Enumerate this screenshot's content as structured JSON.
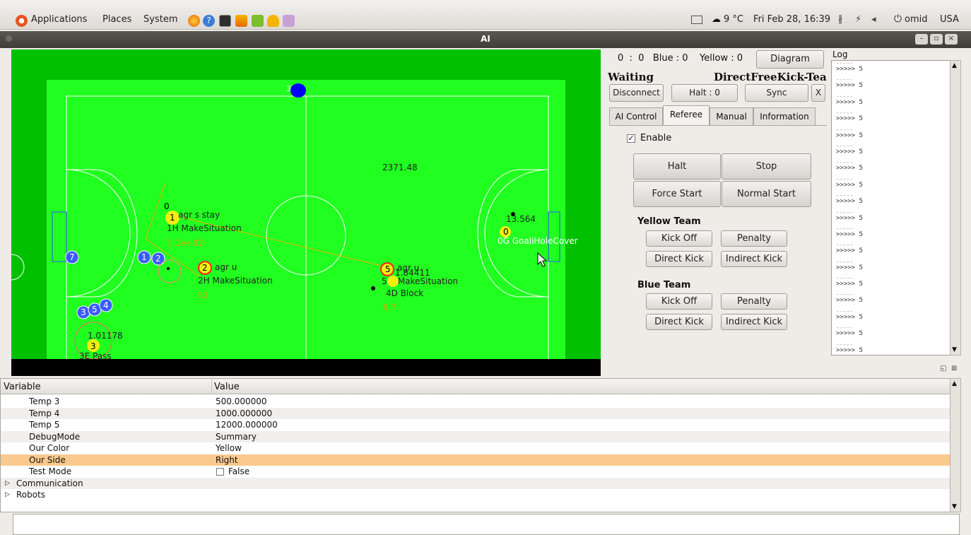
{
  "topbar": {
    "menus": [
      "Applications",
      "Places",
      "System"
    ],
    "weather": "9 °C",
    "datetime": "Fri Feb 28, 16:39",
    "user": "omid",
    "keyboard": "USA"
  },
  "window": {
    "title": "AI"
  },
  "field": {
    "center_value": "2371.48",
    "ball_label": "3",
    "robots": [
      {
        "num": "1",
        "team": "yellow",
        "line1": "agr s stay",
        "line2": "1H MakeSituation",
        "line3": "1.1e+02",
        "top": "0"
      },
      {
        "num": "2",
        "team": "yellow",
        "line1": "agr u",
        "line2": "2H MakeSituation",
        "line3": "51"
      },
      {
        "num": "5",
        "team": "yellow",
        "line1": "agr u",
        "line2": "5 4 MakeSituation",
        "line3": "1.84411"
      },
      {
        "num": "4",
        "team": "yellow",
        "line1": "4D Block",
        "line2": "8.7"
      },
      {
        "num": "0",
        "team": "yellow",
        "line1": "13.564",
        "line2": "0G GoaliHoleCover"
      },
      {
        "num": "3",
        "team": "yellow",
        "line1": "1.01178",
        "line2": "3E Pass"
      },
      {
        "num": "7",
        "team": "blue"
      },
      {
        "num": "1",
        "team": "blue"
      },
      {
        "num": "2",
        "team": "blue"
      },
      {
        "num": "3",
        "team": "blue"
      },
      {
        "num": "5",
        "team": "blue"
      },
      {
        "num": "4",
        "team": "blue"
      }
    ]
  },
  "control": {
    "score": "0  :  0   Blue : 0    Yellow : 0",
    "diagram_button": "Diagram",
    "status": "Waiting",
    "play": "DirectFreeKick-Tea",
    "disconnect_button": "Disconnect",
    "halt_button": "Halt : 0",
    "sync_button": "Sync",
    "close_button": "X",
    "tabs": [
      "AI Control",
      "Referee",
      "Manual",
      "Information"
    ],
    "enable_label": "Enable",
    "halt": "Halt",
    "stop": "Stop",
    "force_start": "Force Start",
    "normal_start": "Normal Start",
    "yellow_team": "Yellow Team",
    "blue_team": "Blue Team",
    "kick_off": "Kick Off",
    "penalty": "Penalty",
    "direct_kick": "Direct Kick",
    "indirect_kick": "Indirect Kick"
  },
  "log": {
    "title": "Log",
    "entries": [
      ">>>>> 5",
      ">>>>> 5",
      ">>>>> 5",
      ">>>>> 5",
      ">>>>> 5",
      ">>>>> 5",
      ">>>>> 5",
      ">>>>> 5",
      ">>>>> 5",
      ">>>>> 5",
      ">>>>> 5",
      ">>>>> 5",
      ">>>>> 5",
      ">>>>> 5",
      ">>>>> 5",
      ">>>>> 5",
      ">>>>> 5",
      ">>>>> 5"
    ]
  },
  "variables": {
    "col_variable": "Variable",
    "col_value": "Value",
    "rows": [
      {
        "name": "Temp 3",
        "value": "500.000000"
      },
      {
        "name": "Temp 4",
        "value": "1000.000000"
      },
      {
        "name": "Temp 5",
        "value": "12000.000000"
      },
      {
        "name": "DebugMode",
        "value": "Summary"
      },
      {
        "name": "Our Color",
        "value": "Yellow"
      },
      {
        "name": "Our Side",
        "value": "Right"
      },
      {
        "name": "Test Mode",
        "value": "False"
      },
      {
        "name": "Communication",
        "value": ""
      },
      {
        "name": "Robots",
        "value": ""
      }
    ]
  }
}
